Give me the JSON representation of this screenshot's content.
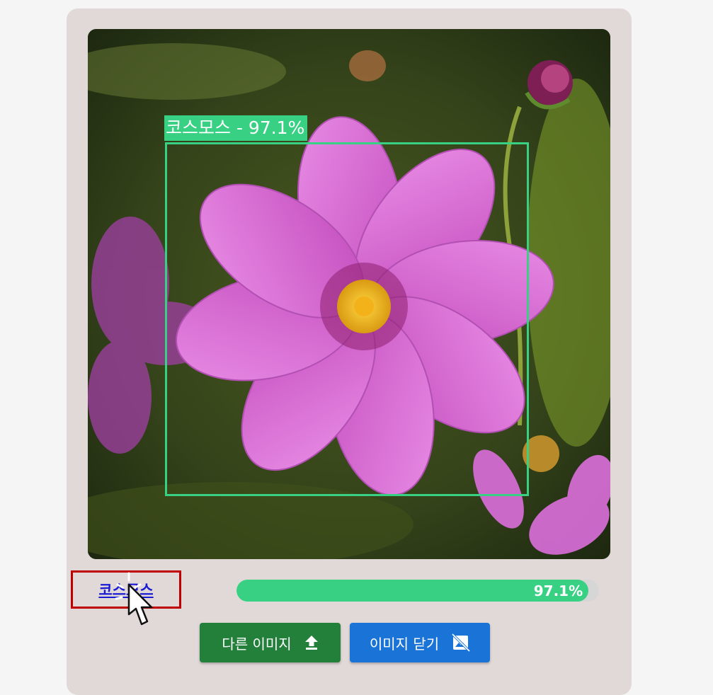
{
  "detection": {
    "overlay_label": "코스모스 - 97.1%",
    "box_color": "#38d083",
    "confidence": 97.1
  },
  "result": {
    "label": "코스모스",
    "percent_text": "97.1%",
    "percent": 97.1
  },
  "buttons": {
    "upload_label": "다른 이미지",
    "upload_icon": "upload-icon",
    "close_label": "이미지 닫기",
    "close_icon": "image-off-icon"
  },
  "colors": {
    "accent_green": "#38d083",
    "upload_button": "#22803a",
    "close_button": "#1a74d8",
    "highlight_border": "#c00000",
    "link": "#1a1ad4"
  }
}
